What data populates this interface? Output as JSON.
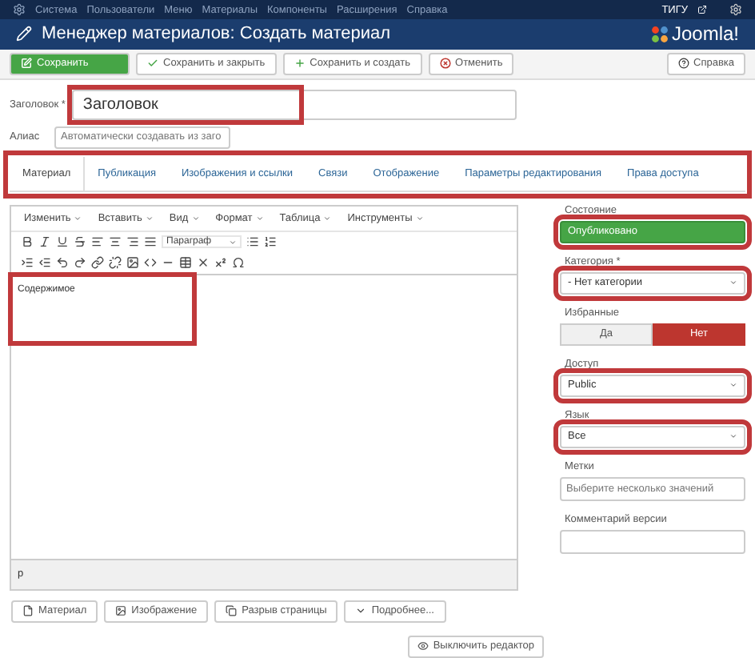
{
  "top_menu": {
    "items": [
      "Система",
      "Пользователи",
      "Меню",
      "Материалы",
      "Компоненты",
      "Расширения",
      "Справка"
    ],
    "user": "ТИГУ"
  },
  "header": {
    "title": "Менеджер материалов: Создать материал",
    "logo": "Joomla!"
  },
  "toolbar": {
    "buttons": [
      {
        "kind": "save",
        "label": "Сохранить"
      },
      {
        "kind": "save-close",
        "label": "Сохранить и закрыть"
      },
      {
        "kind": "save-new",
        "label": "Сохранить и создать"
      },
      {
        "kind": "cancel",
        "label": "Отменить"
      }
    ],
    "help": "Справка"
  },
  "title_field": {
    "label": "Заголовок *",
    "value": "Заголовок",
    "highlighted": true
  },
  "alias_field": {
    "label": "Алиас",
    "placeholder": "Автоматически создавать из заго"
  },
  "tabs": {
    "highlighted": true,
    "items": [
      {
        "label": "Материал",
        "selected": true
      },
      {
        "label": "Публикация",
        "selected": false
      },
      {
        "label": "Изображения и ссылки",
        "selected": false
      },
      {
        "label": "Связи",
        "selected": false
      },
      {
        "label": "Отображение",
        "selected": false
      },
      {
        "label": "Параметры редактирования",
        "selected": false
      },
      {
        "label": "Права доступа",
        "selected": false
      }
    ]
  },
  "editor": {
    "menus": [
      "Изменить",
      "Вставить",
      "Вид",
      "Формат",
      "Таблица",
      "Инструменты"
    ],
    "format_select": "Параграф",
    "content": "Содержимое",
    "content_highlighted": true,
    "path": "p"
  },
  "editor_buttons": [
    {
      "kind": "article",
      "label": "Материал"
    },
    {
      "kind": "image",
      "label": "Изображение"
    },
    {
      "kind": "pagebreak",
      "label": "Разрыв страницы"
    },
    {
      "kind": "readmore",
      "label": "Подробнее..."
    }
  ],
  "toggle_editor": "Выключить редактор",
  "sidebar": {
    "state": {
      "label": "Состояние",
      "value": "Опубликовано",
      "highlighted": true
    },
    "category": {
      "label": "Категория *",
      "value": "- Нет категории",
      "highlighted": true
    },
    "featured": {
      "label": "Избранные",
      "options": [
        {
          "label": "Да",
          "selected": false
        },
        {
          "label": "Нет",
          "selected": true
        }
      ]
    },
    "access": {
      "label": "Доступ",
      "value": "Public",
      "highlighted": true
    },
    "language": {
      "label": "Язык",
      "value": "Все",
      "highlighted": true
    },
    "tags": {
      "label": "Метки",
      "placeholder": "Выберите несколько значений"
    },
    "version_note": {
      "label": "Комментарий версии"
    }
  }
}
